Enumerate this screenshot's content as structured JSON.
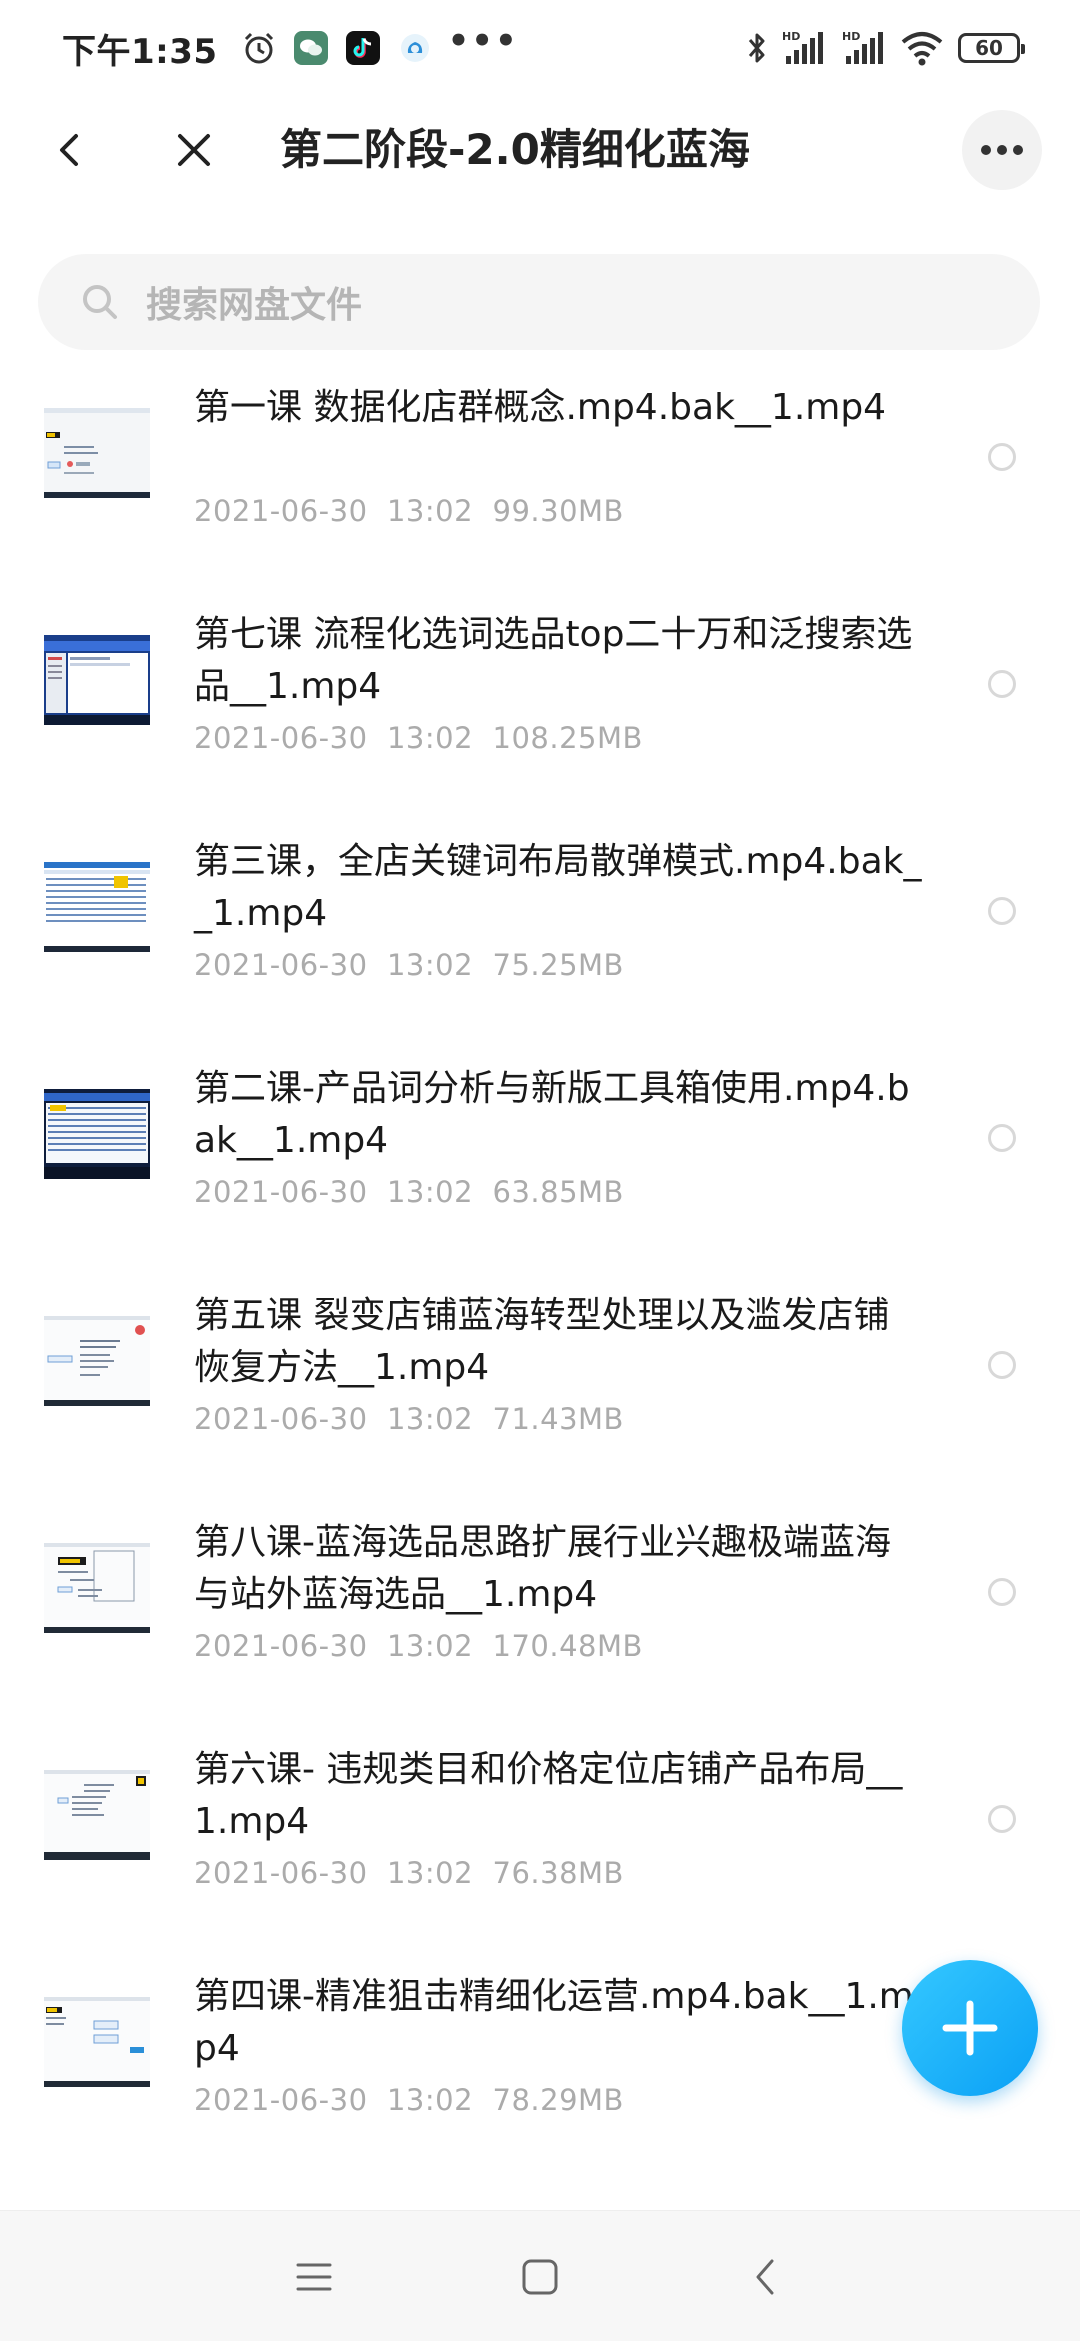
{
  "status_bar": {
    "time": "下午1:35",
    "battery": "60",
    "icons": [
      "alarm-icon",
      "wechat-icon",
      "tiktok-icon",
      "cloud-app-icon",
      "more-dots-icon",
      "bluetooth-icon",
      "signal-hd-icon",
      "signal-hd-icon",
      "wifi-icon",
      "battery-icon"
    ]
  },
  "header": {
    "title": "第二阶段-2.0精细化蓝海"
  },
  "search": {
    "placeholder": "搜索网盘文件"
  },
  "files": [
    {
      "name": "第一课  数据化店群概念.mp4.bak__1.mp4",
      "date": "2021-06-30",
      "time": "13:02",
      "size": "99.30MB",
      "thumb": "light"
    },
    {
      "name": "第七课 流程化选词选品top二十万和泛搜索选品__1.mp4",
      "date": "2021-06-30",
      "time": "13:02",
      "size": "108.25MB",
      "thumb": "dark"
    },
    {
      "name": "第三课，全店关键词布局散弹模式.mp4.bak__1.mp4",
      "date": "2021-06-30",
      "time": "13:02",
      "size": "75.25MB",
      "thumb": "table"
    },
    {
      "name": "第二课-产品词分析与新版工具箱使用.mp4.bak__1.mp4",
      "date": "2021-06-30",
      "time": "13:02",
      "size": "63.85MB",
      "thumb": "dark-table"
    },
    {
      "name": "第五课 裂变店铺蓝海转型处理以及滥发店铺恢复方法__1.mp4",
      "date": "2021-06-30",
      "time": "13:02",
      "size": "71.43MB",
      "thumb": "light"
    },
    {
      "name": "第八课-蓝海选品思路扩展行业兴趣极端蓝海与站外蓝海选品__1.mp4",
      "date": "2021-06-30",
      "time": "13:02",
      "size": "170.48MB",
      "thumb": "light"
    },
    {
      "name": "第六课- 违规类目和价格定位店铺产品布局__1.mp4",
      "date": "2021-06-30",
      "time": "13:02",
      "size": "76.38MB",
      "thumb": "light"
    },
    {
      "name": "第四课-精准狙击精细化运营.mp4.bak__1.mp4",
      "date": "2021-06-30",
      "time": "13:02",
      "size": "78.29MB",
      "thumb": "light"
    }
  ],
  "colors": {
    "accent": "#1aa7f8",
    "meta_text": "#ababab",
    "primary_text": "#1a1a1a"
  }
}
